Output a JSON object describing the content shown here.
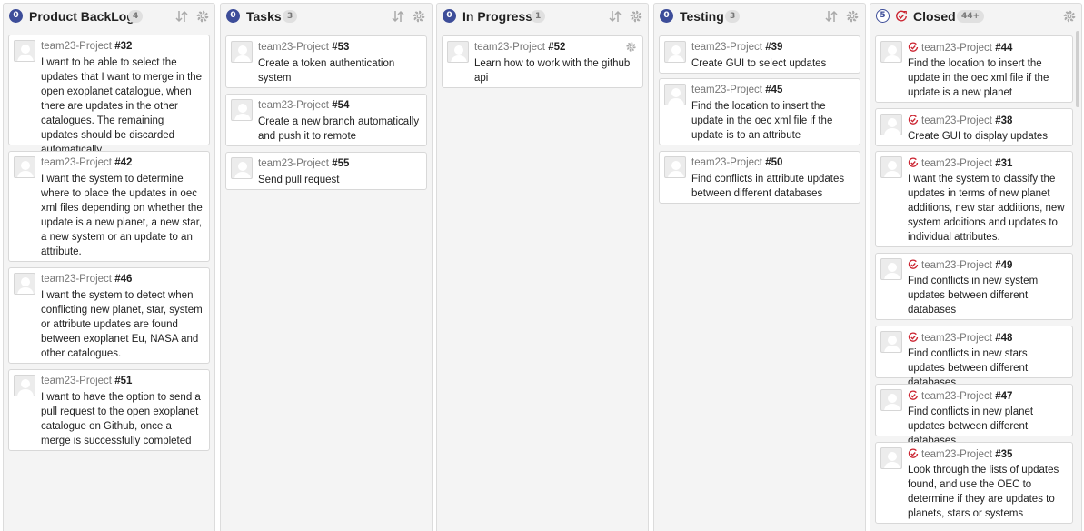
{
  "columns": [
    {
      "title": "Product BackLog",
      "badge": "0",
      "total": "4",
      "cards": [
        {
          "repo": "team23-Project",
          "number": "#32",
          "title": "I want to be able to select the updates that I want to merge in the open exoplanet catalogue, when there are updates in the other catalogues. The remaining updates should be discarded automatically."
        },
        {
          "repo": "team23-Project",
          "number": "#42",
          "title": "I want the system to determine where to place the updates in oec xml files depending on whether the update is a new planet, a new star, a new system or an update to an attribute."
        },
        {
          "repo": "team23-Project",
          "number": "#46",
          "title": "I want the system to detect when conflicting new planet, star, system or attribute updates are found between exoplanet Eu, NASA and other catalogues."
        },
        {
          "repo": "team23-Project",
          "number": "#51",
          "title": "I want to have the option to send a pull request to the open exoplanet catalogue on Github, once a merge is successfully completed"
        }
      ]
    },
    {
      "title": "Tasks",
      "badge": "0",
      "total": "3",
      "cards": [
        {
          "repo": "team23-Project",
          "number": "#53",
          "title": "Create a token authentication system"
        },
        {
          "repo": "team23-Project",
          "number": "#54",
          "title": "Create a new branch automatically and push it to remote"
        },
        {
          "repo": "team23-Project",
          "number": "#55",
          "title": "Send pull request"
        }
      ]
    },
    {
      "title": "In Progress",
      "badge": "0",
      "total": "1",
      "cards": [
        {
          "repo": "team23-Project",
          "number": "#52",
          "title": "Learn how to work with the github api"
        }
      ]
    },
    {
      "title": "Testing",
      "badge": "0",
      "total": "3",
      "cards": [
        {
          "repo": "team23-Project",
          "number": "#39",
          "title": "Create GUI to select updates"
        },
        {
          "repo": "team23-Project",
          "number": "#45",
          "title": "Find the location to insert the update in the oec xml file if the update is to an attribute"
        },
        {
          "repo": "team23-Project",
          "number": "#50",
          "title": "Find conflicts in attribute updates between different databases"
        }
      ]
    },
    {
      "title": "Closed",
      "badge": "5",
      "total": "44+",
      "cards": [
        {
          "repo": "team23-Project",
          "number": "#44",
          "title": "Find the location to insert the update in the oec xml file if the update is a new planet"
        },
        {
          "repo": "team23-Project",
          "number": "#38",
          "title": "Create GUI to display updates"
        },
        {
          "repo": "team23-Project",
          "number": "#31",
          "title": "I want the system to classify the updates in terms of new planet additions, new star additions, new system additions and updates to individual attributes."
        },
        {
          "repo": "team23-Project",
          "number": "#49",
          "title": "Find conflicts in new system updates between different databases"
        },
        {
          "repo": "team23-Project",
          "number": "#48",
          "title": "Find conflicts in new stars updates between different databases"
        },
        {
          "repo": "team23-Project",
          "number": "#47",
          "title": "Find conflicts in new planet updates between different databases"
        },
        {
          "repo": "team23-Project",
          "number": "#35",
          "title": "Look through the lists of updates found, and use the OEC to determine if they are updates to planets, stars or systems"
        }
      ]
    }
  ],
  "icons": {
    "sort": "sort-arrows-icon",
    "settings": "gear-icon",
    "closed": "closed-issue-icon",
    "avatar": "avatar-placeholder-icon"
  },
  "colors": {
    "badge": "#3d4d99",
    "closed": "#cb2431"
  }
}
